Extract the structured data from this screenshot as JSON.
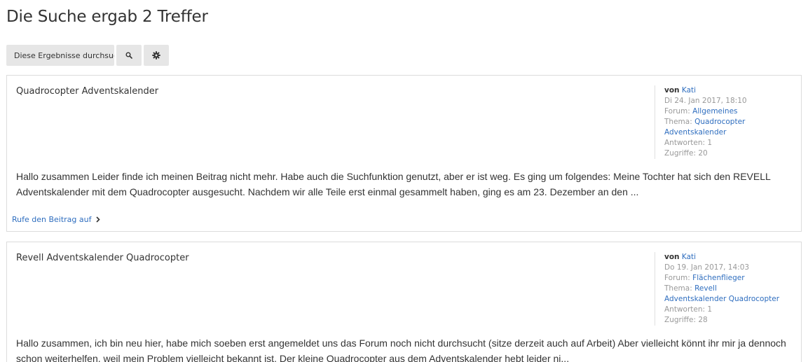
{
  "page": {
    "title": "Die Suche ergab 2 Treffer"
  },
  "toolbar": {
    "search_value": "Diese Ergebnisse durchsuch",
    "search_icon": "search-icon",
    "settings_icon": "gear-icon"
  },
  "colors": {
    "link": "#2f6ebf",
    "muted": "#999999",
    "button_bg": "#e6e6e6",
    "border": "#dcdcdc"
  },
  "results": [
    {
      "title": "Quadrocopter Adventskalender",
      "author_label": "von",
      "author": "Kati",
      "date": "Di 24. Jan 2017, 18:10",
      "forum_label": "Forum:",
      "forum": "Allgemeines",
      "topic_label": "Thema:",
      "topic": "Quadrocopter Adventskalender",
      "replies": "Antworten: 1",
      "views": "Zugriffe: 20",
      "excerpt": "Hallo zusammen Leider finde ich meinen Beitrag nicht mehr. Habe auch die Suchfunktion genutzt, aber er ist weg. Es ging um folgendes: Meine Tochter hat sich den REVELL Adventskalender mit dem Quadrocopter ausgesucht. Nachdem wir alle Teile erst einmal gesammelt haben, ging es am 23. Dezember an den ...",
      "open_link": "Rufe den Beitrag auf"
    },
    {
      "title": "Revell Adventskalender Quadrocopter",
      "author_label": "von",
      "author": "Kati",
      "date": "Do 19. Jan 2017, 14:03",
      "forum_label": "Forum:",
      "forum": "Flächenflieger",
      "topic_label": "Thema:",
      "topic": "Revell Adventskalender Quadrocopter",
      "replies": "Antworten: 1",
      "views": "Zugriffe: 28",
      "excerpt": "Hallo zusammen, ich bin neu hier, habe mich soeben erst angemeldet uns das Forum noch nicht durchsucht (sitze derzeit auch auf Arbeit) Aber vielleicht könnt ihr mir ja dennoch schon weiterhelfen, weil mein Problem vielleicht bekannt ist. Der kleine Quadrocopter aus dem Adventskalender hebt leider ni..."
    }
  ]
}
